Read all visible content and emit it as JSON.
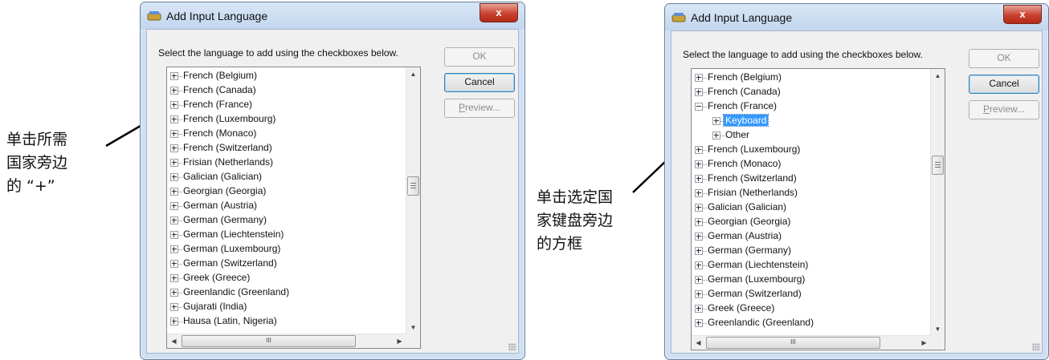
{
  "annotations": {
    "left": "单击所需\n国家旁边\n的 “+”",
    "right": "单击选定国\n家键盘旁边\n的方框"
  },
  "dialog_left": {
    "title": "Add Input Language",
    "close_label": "x",
    "prompt": "Select the language to add using the checkboxes below.",
    "ok_label": "OK",
    "cancel_label": "Cancel",
    "preview_mnemonic": "P",
    "preview_rest": "review...",
    "hscroll_thumb_label": "III",
    "tree": [
      {
        "label": "French (Belgium)",
        "expanded": false
      },
      {
        "label": "French (Canada)",
        "expanded": false
      },
      {
        "label": "French (France)",
        "expanded": false
      },
      {
        "label": "French (Luxembourg)",
        "expanded": false
      },
      {
        "label": "French (Monaco)",
        "expanded": false
      },
      {
        "label": "French (Switzerland)",
        "expanded": false
      },
      {
        "label": "Frisian (Netherlands)",
        "expanded": false
      },
      {
        "label": "Galician (Galician)",
        "expanded": false
      },
      {
        "label": "Georgian (Georgia)",
        "expanded": false
      },
      {
        "label": "German (Austria)",
        "expanded": false
      },
      {
        "label": "German (Germany)",
        "expanded": false
      },
      {
        "label": "German (Liechtenstein)",
        "expanded": false
      },
      {
        "label": "German (Luxembourg)",
        "expanded": false
      },
      {
        "label": "German (Switzerland)",
        "expanded": false
      },
      {
        "label": "Greek (Greece)",
        "expanded": false
      },
      {
        "label": "Greenlandic (Greenland)",
        "expanded": false
      },
      {
        "label": "Gujarati (India)",
        "expanded": false
      },
      {
        "label": "Hausa (Latin, Nigeria)",
        "expanded": false
      }
    ]
  },
  "dialog_right": {
    "title": "Add Input Language",
    "close_label": "x",
    "prompt": "Select the language to add using the checkboxes below.",
    "ok_label": "OK",
    "cancel_label": "Cancel",
    "preview_mnemonic": "P",
    "preview_rest": "review...",
    "hscroll_thumb_label": "III",
    "tree": [
      {
        "label": "French (Belgium)",
        "expanded": false
      },
      {
        "label": "French (Canada)",
        "expanded": false
      },
      {
        "label": "French (France)",
        "expanded": true
      },
      {
        "label": "Keyboard",
        "expanded": false,
        "child": true,
        "selected": true
      },
      {
        "label": "Other",
        "expanded": false,
        "child": true
      },
      {
        "label": "French (Luxembourg)",
        "expanded": false
      },
      {
        "label": "French (Monaco)",
        "expanded": false
      },
      {
        "label": "French (Switzerland)",
        "expanded": false
      },
      {
        "label": "Frisian (Netherlands)",
        "expanded": false
      },
      {
        "label": "Galician (Galician)",
        "expanded": false
      },
      {
        "label": "Georgian (Georgia)",
        "expanded": false
      },
      {
        "label": "German (Austria)",
        "expanded": false
      },
      {
        "label": "German (Germany)",
        "expanded": false
      },
      {
        "label": "German (Liechtenstein)",
        "expanded": false
      },
      {
        "label": "German (Luxembourg)",
        "expanded": false
      },
      {
        "label": "German (Switzerland)",
        "expanded": false
      },
      {
        "label": "Greek (Greece)",
        "expanded": false
      },
      {
        "label": "Greenlandic (Greenland)",
        "expanded": false
      }
    ]
  }
}
